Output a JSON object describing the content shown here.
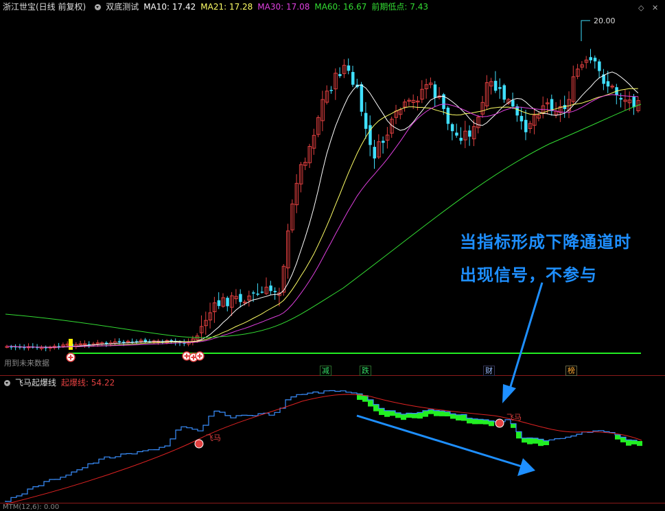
{
  "header": {
    "title": "浙江世宝(日线 前复权)",
    "indicator": "双底测试",
    "ma10": "MA10: 17.42",
    "ma21": "MA21: 17.28",
    "ma30": "MA30: 17.08",
    "ma60": "MA60: 16.67",
    "low": "前期低点: 7.43"
  },
  "colors": {
    "ma10": "#ffffff",
    "ma21": "#ffff66",
    "ma30": "#e040e0",
    "ma60": "#33dd33",
    "up": "#e24040",
    "down": "#40e0ff",
    "note": "#1e8fff"
  },
  "price_label": "20.00",
  "corner_text": "用到未来数据",
  "event_tags": [
    {
      "text": "减",
      "color": "#33dd66"
    },
    {
      "text": "跌",
      "color": "#33dd66"
    },
    {
      "text": "财",
      "color": "#99bbff"
    },
    {
      "text": "榜",
      "color": "#ffaa33"
    }
  ],
  "annotation": {
    "line1": "当指标形成下降通道时",
    "line2": "出现信号，不参与"
  },
  "sub_header": {
    "title": "飞马起爆线",
    "value": "起爆线: 54.22"
  },
  "signal_label": "飞马",
  "bottom_text": "MTM(12,6): 0.00"
}
